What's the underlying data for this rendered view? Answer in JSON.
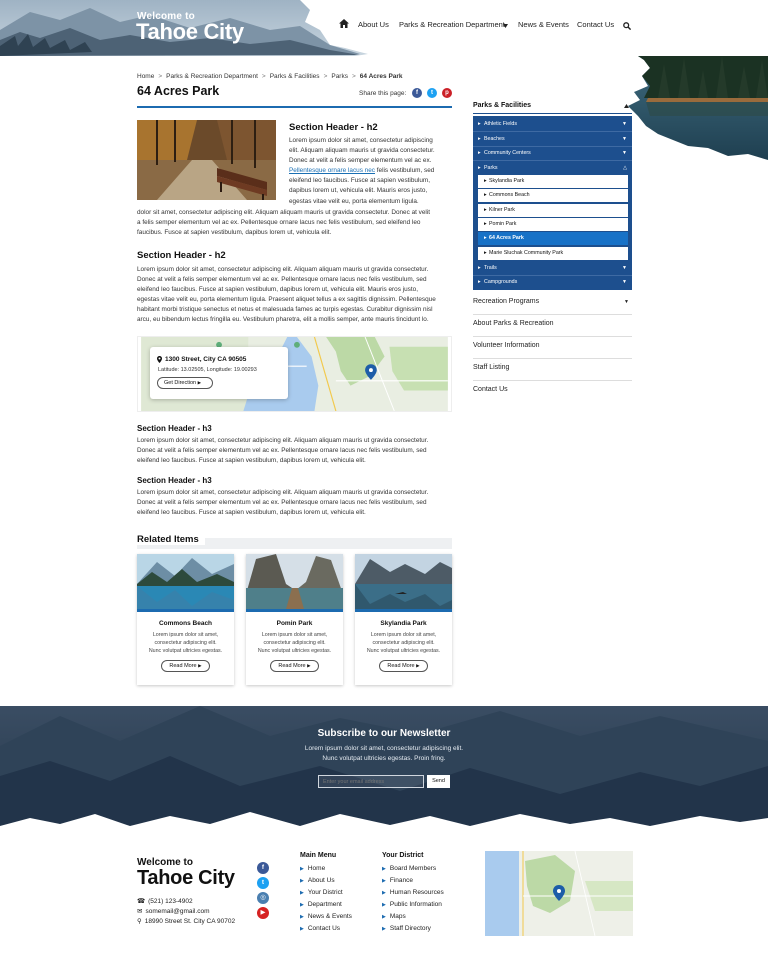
{
  "header": {
    "welcome": "Welcome to",
    "city": "Tahoe City",
    "nav": [
      "About Us",
      "Parks & Recreation Department",
      "News & Events",
      "Contact Us"
    ]
  },
  "breadcrumb": [
    "Home",
    "Parks & Recreation Department",
    "Parks & Facilities",
    "Parks",
    "64 Acres Park"
  ],
  "page_title": "64 Acres Park",
  "share_label": "Share this page:",
  "share_icons": [
    "facebook-icon",
    "twitter-icon",
    "pinterest-icon"
  ],
  "section1": {
    "heading": "Section Header - h2",
    "lines": [
      "Lorem ipsum dolor sit amet, consectetur adipiscing",
      "elit. Aliquam aliquam mauris ut gravida consectetur.",
      "Donec at velit a felis semper elementum vel ac ex.",
      "felis vestibulum, sed",
      "eleifend leo faucibus. Fusce at sapien vestibulum,",
      "dapibus lorem ut, vehicula elit. Mauris eros justo,",
      "egestas vitae velit eu, porta elementum ligula."
    ],
    "link": "Pellentesque ornare lacus nec",
    "wrap_lines": [
      "dolor sit amet, consectetur adipiscing elit. Aliquam aliquam mauris ut gravida consectetur. Donec at velit",
      "a felis semper elementum vel ac ex. Pellentesque ornare lacus nec felis vestibulum, sed eleifend leo",
      "faucibus. Fusce at sapien vestibulum, dapibus lorem ut, vehicula elit."
    ]
  },
  "section2": {
    "heading": "Section Header - h2",
    "lines": [
      "Lorem ipsum dolor sit amet, consectetur adipiscing elit. Aliquam aliquam mauris ut gravida consectetur.",
      "Donec at velit a felis semper elementum vel ac ex. Pellentesque ornare lacus nec felis vestibulum, sed",
      "eleifend leo faucibus. Fusce at sapien vestibulum, dapibus lorem ut, vehicula elit. Mauris eros justo,",
      "egestas vitae velit eu, porta elementum ligula. Praesent aliquet tellus a ex sagittis dignissim. Pellentesque",
      "habitant morbi tristique senectus et netus et malesuada fames ac turpis egestas. Curabitur dignissim nisl",
      "arcu, eu bibendum lectus fringilla eu. Vestibulum pharetra, elit a mollis semper, ante mauris tincidunt lo."
    ]
  },
  "map_card": {
    "address": "1300 Street, City CA 90505",
    "latlong": "Latitude: 13.02505, Longitude: 19.00293",
    "button": "Get Direction"
  },
  "section3": {
    "heading": "Section Header - h3",
    "lines": [
      "Lorem ipsum dolor sit amet, consectetur adipiscing elit. Aliquam aliquam mauris ut gravida consectetur.",
      "Donec at velit a felis semper elementum vel ac ex.  Pellentesque ornare lacus nec felis vestibulum, sed",
      "eleifend leo faucibus. Fusce at sapien vestibulum, dapibus lorem ut, vehicula elit."
    ]
  },
  "section4": {
    "heading": "Section Header - h3",
    "lines": [
      "Lorem ipsum dolor sit amet, consectetur adipiscing elit. Aliquam aliquam mauris ut gravida consectetur.",
      "Donec at velit a felis semper elementum vel ac ex.  Pellentesque ornare lacus nec felis vestibulum, sed",
      "eleifend leo faucibus. Fusce at sapien vestibulum, dapibus lorem ut, vehicula elit."
    ]
  },
  "related": {
    "title": "Related Items",
    "cards": [
      {
        "title": "Commons Beach",
        "desc": [
          "Lorem ipsum dolor sit amet,",
          "consectetur adipiscing elit.",
          "Nunc volutpat ultricies egestas."
        ],
        "button": "Read More"
      },
      {
        "title": "Pomin Park",
        "desc": [
          "Lorem ipsum dolor sit amet,",
          "consectetur adipiscing elit.",
          "Nunc volutpat ultricies egestas."
        ],
        "button": "Read More"
      },
      {
        "title": "Skylandia Park",
        "desc": [
          "Lorem ipsum dolor sit amet,",
          "consectetur adipiscing elit.",
          "Nunc volutpat ultricies egestas."
        ],
        "button": "Read More"
      }
    ]
  },
  "sidebar": {
    "title": "Parks & Facilities",
    "groups": [
      "Athletic Fields",
      "Beaches",
      "Community Centers",
      "Parks"
    ],
    "parks": [
      "Skylandia Park",
      "Commons Beach",
      "Kilner Park",
      "Pomin Park",
      "64 Acres Park",
      "Marie Sluchak Community Park"
    ],
    "groups_after": [
      "Trails",
      "Campgrounds"
    ],
    "links": [
      "Recreation Programs",
      "About Parks & Recreation",
      "Volunteer Information",
      "Staff Listing",
      "Contact Us"
    ]
  },
  "newsletter": {
    "title": "Subscribe to our Newsletter",
    "desc": [
      "Lorem ipsum dolor sit amet, consectetur adipiscing elit.",
      "Nunc volutpat ultricies egestas. Proin fring."
    ],
    "placeholder": "Enter your email address",
    "button": "Send"
  },
  "footer": {
    "welcome": "Welcome to",
    "city": "Tahoe City",
    "phone": "(521) 123-4902",
    "email": "somemail@gmail.com",
    "address": "18990 Street St. City CA 90702",
    "main_menu_title": "Main Menu",
    "main_menu": [
      "Home",
      "About Us",
      "Your District",
      "Department",
      "News & Events",
      "Contact Us"
    ],
    "district_title": "Your District",
    "district": [
      "Board Members",
      "Finance",
      "Human Resources",
      "Public Information",
      "Maps",
      "Staff Directory"
    ]
  },
  "colors": {
    "brand_blue": "#1c6bb0",
    "sidebar_blue": "#1d4f8e",
    "active_blue": "#1872c7",
    "facebook": "#3b5998",
    "twitter": "#1da1f2",
    "pinterest": "#cb2027",
    "youtube": "#d62222",
    "instagram": "#4a7fb0"
  }
}
